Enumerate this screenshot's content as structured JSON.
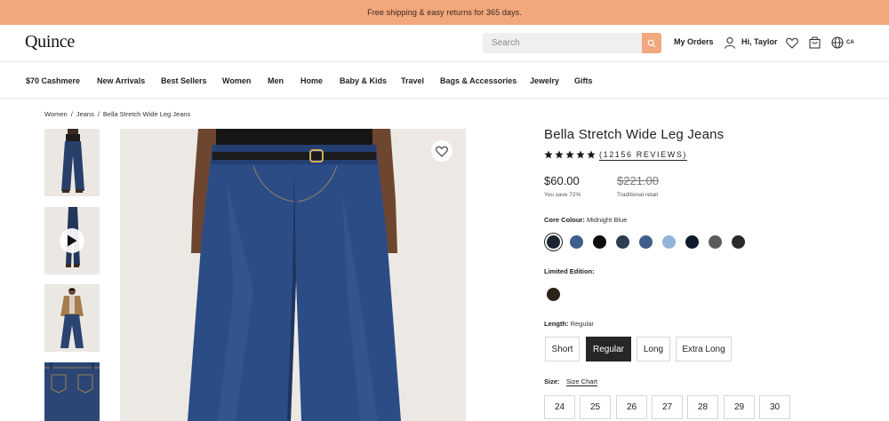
{
  "promo": {
    "text": "Free shipping & easy returns for 365 days."
  },
  "header": {
    "logo": "Quince",
    "search_placeholder": "Search",
    "my_orders": "My Orders",
    "greeting": "Hi, Taylor",
    "region": "CA",
    "icons": [
      "search-icon",
      "user-icon",
      "heart-icon",
      "cart-icon",
      "globe-icon"
    ]
  },
  "nav": {
    "items": [
      "$70 Cashmere",
      "New Arrivals",
      "Best Sellers",
      "Women",
      "Men",
      "Home",
      "Baby & Kids",
      "Travel",
      "Bags & Accessories",
      "Jewelry",
      "Gifts"
    ]
  },
  "breadcrumb": {
    "items": [
      "Women",
      "Jeans",
      "Bella Stretch Wide Leg Jeans"
    ]
  },
  "gallery": {
    "thumbnails": 4,
    "video_thumbnail_index": 1
  },
  "product": {
    "title": "Bella Stretch Wide Leg Jeans",
    "rating_stars": 5,
    "reviews_label": "(12156 REVIEWS)",
    "price": "$60.00",
    "save_label": "You save 72%",
    "retail_price": "$221.00",
    "retail_label": "Traditional retail",
    "colour_label": "Core Colour:",
    "colour_value": "Midnight Blue",
    "colours": [
      "#1c2433",
      "#3d5f8c",
      "#0d0d0d",
      "#2e3c52",
      "#3f5f8a",
      "#93b4d6",
      "#111a2c",
      "#5b5b5b",
      "#2a2a2a"
    ],
    "limited_label": "Limited Edition:",
    "limited_colour": "#2b2219",
    "length_label": "Length:",
    "length_value": "Regular",
    "lengths": [
      "Short",
      "Regular",
      "Long",
      "Extra Long"
    ],
    "selected_length": "Regular",
    "size_label": "Size:",
    "size_chart": "Size Chart",
    "sizes": [
      "24",
      "25",
      "26",
      "27",
      "28",
      "29",
      "30"
    ]
  },
  "colors": {
    "accent": "#f2a77c",
    "selected": "#262626"
  }
}
